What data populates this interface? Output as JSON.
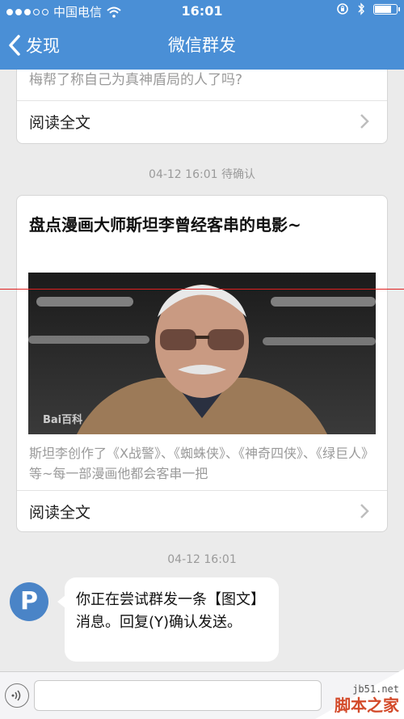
{
  "status_bar": {
    "carrier": "中国电信",
    "time": "16:01",
    "battery_level": 0.85
  },
  "nav": {
    "back_label": "发现",
    "title": "微信群发"
  },
  "messages": [
    {
      "type": "article",
      "summary": "梅帮了称自己为真神盾局的人了吗?",
      "read_more": "阅读全文"
    },
    {
      "timestamp": "04-12 16:01 待确认",
      "type": "article",
      "title": "盘点漫画大师斯坦李曾经客串的电影~",
      "image_watermark": "Bai百科",
      "summary": "斯坦李创作了《X战警》、《蜘蛛侠》、《神奇四侠》、《绿巨人》等~每一部漫画他都会客串一把",
      "read_more": "阅读全文"
    },
    {
      "timestamp": "04-12 16:01",
      "type": "text",
      "avatar_letter": "P",
      "text": "你正在尝试群发一条【图文】消息。回复(Y)确认发送。"
    }
  ],
  "input_bar": {
    "placeholder": ""
  },
  "watermark": {
    "url": "jb51.net",
    "name": "脚本之家"
  },
  "colors": {
    "nav_bar": "#4a8fd6",
    "avatar": "#4a84c7",
    "guide_line": "#e02020"
  },
  "icons": {
    "back": "chevron-left-icon",
    "read_more": "chevron-right-icon",
    "voice": "voice-icon",
    "wifi": "wifi-icon",
    "bluetooth": "bluetooth-icon",
    "orientation_lock": "orientation-lock-icon"
  }
}
